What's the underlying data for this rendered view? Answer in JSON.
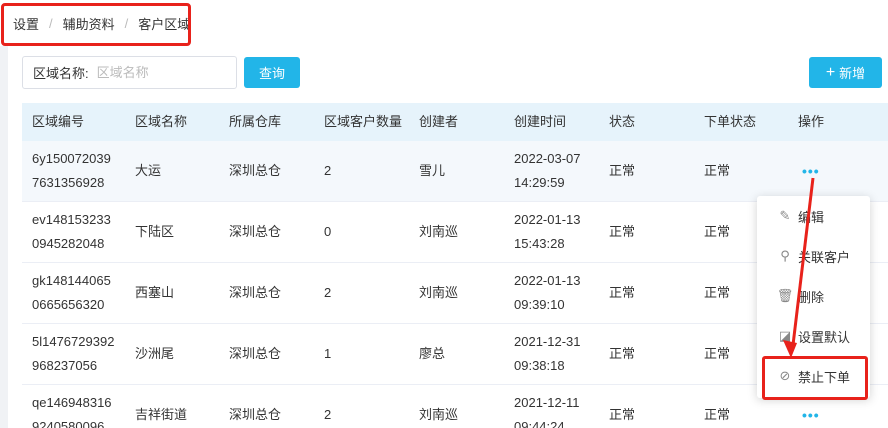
{
  "breadcrumb": [
    "设置",
    "辅助资料",
    "客户区域"
  ],
  "search": {
    "label": "区域名称:",
    "placeholder": "区域名称"
  },
  "buttons": {
    "query": "查询",
    "add": "新增",
    "add_icon": "plus-icon"
  },
  "table": {
    "headers": [
      "区域编号",
      "区域名称",
      "所属仓库",
      "区域客户数量",
      "创建者",
      "创建时间",
      "状态",
      "下单状态",
      "操作"
    ],
    "rows": [
      {
        "code": [
          "6y150072039",
          "7631356928"
        ],
        "name": "大运",
        "warehouse": "深圳总仓",
        "count": "2",
        "creator": "雪儿",
        "time": [
          "2022-03-07",
          "14:29:59"
        ],
        "status": "正常",
        "order_status": "正常",
        "ops": "•••"
      },
      {
        "code": [
          "ev148153233",
          "0945282048"
        ],
        "name": "下陆区",
        "warehouse": "深圳总仓",
        "count": "0",
        "creator": "刘南巡",
        "time": [
          "2022-01-13",
          "15:43:28"
        ],
        "status": "正常",
        "order_status": "正常",
        "ops": ""
      },
      {
        "code": [
          "gk148144065",
          "0665656320"
        ],
        "name": "西塞山",
        "warehouse": "深圳总仓",
        "count": "2",
        "creator": "刘南巡",
        "time": [
          "2022-01-13",
          "09:39:10"
        ],
        "status": "正常",
        "order_status": "正常",
        "ops": ""
      },
      {
        "code": [
          "5l1476729392",
          "968237056"
        ],
        "name": "沙洲尾",
        "warehouse": "深圳总仓",
        "count": "1",
        "creator": "廖总",
        "time": [
          "2021-12-31",
          "09:38:18"
        ],
        "status": "正常",
        "order_status": "正常",
        "ops": ""
      },
      {
        "code": [
          "qe146948316",
          "9240580096"
        ],
        "name": "吉祥街道",
        "warehouse": "深圳总仓",
        "count": "2",
        "creator": "刘南巡",
        "time": [
          "2021-12-11",
          "09:44:24"
        ],
        "status": "正常",
        "order_status": "正常",
        "ops": "•••"
      }
    ]
  },
  "dropdown": [
    {
      "label": "编辑",
      "icon": "edit-icon"
    },
    {
      "label": "关联客户",
      "icon": "link-icon"
    },
    {
      "label": "删除",
      "icon": "trash-icon"
    },
    {
      "label": "设置默认",
      "icon": "default-icon"
    },
    {
      "label": "禁止下单",
      "icon": "ban-icon"
    }
  ],
  "colors": {
    "accent": "#22b5e8",
    "highlight": "#e8221b",
    "header_bg": "#e6f3fb"
  }
}
